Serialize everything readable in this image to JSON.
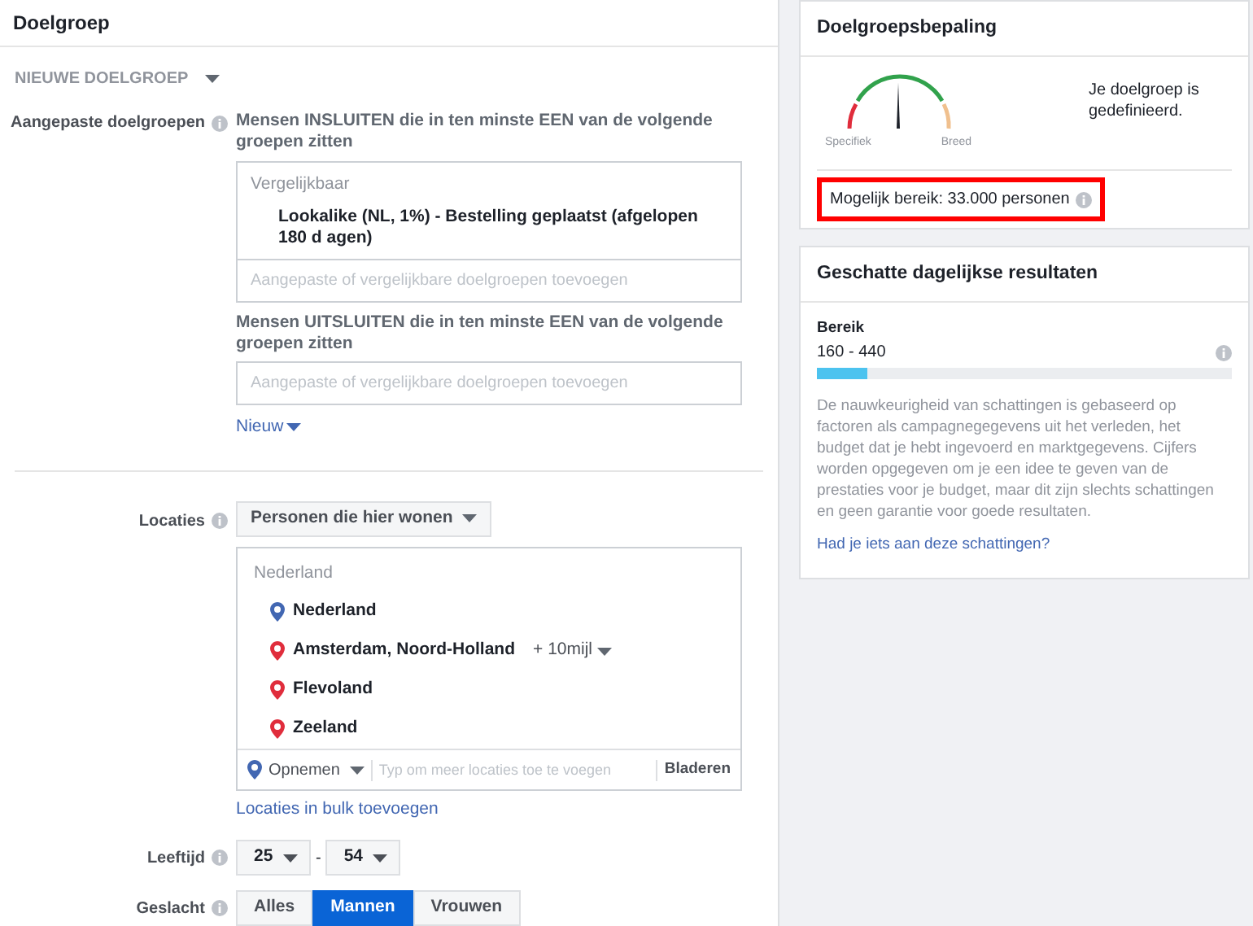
{
  "main": {
    "title": "Doelgroep",
    "audience_menu": "NIEUWE DOELGROEP",
    "custom_audiences": {
      "label": "Aangepaste doelgroepen",
      "include_heading": "Mensen INSLUITEN die in ten minste EEN van de volgende groepen zitten",
      "group_heading": "Vergelijkbaar",
      "items": [
        "Lookalike (NL, 1%) - Bestelling geplaatst (afgelopen 180 d agen)"
      ],
      "include_placeholder": "Aangepaste of vergelijkbare doelgroepen toevoegen",
      "exclude_heading": "Mensen UITSLUITEN die in ten minste EEN van de volgende groepen zitten",
      "exclude_placeholder": "Aangepaste of vergelijkbare doelgroepen toevoegen",
      "new_link": "Nieuw"
    },
    "locations": {
      "label": "Locaties",
      "type_select": "Personen die hier wonen",
      "group_heading": "Nederland",
      "items": [
        {
          "name": "Nederland",
          "kind": "include"
        },
        {
          "name": "Amsterdam, Noord-Holland",
          "kind": "exclude",
          "radius": "+ 10mijl"
        },
        {
          "name": "Flevoland",
          "kind": "exclude"
        },
        {
          "name": "Zeeland",
          "kind": "exclude"
        }
      ],
      "mode_select": "Opnemen",
      "placeholder": "Typ om meer locaties toe te voegen",
      "browse": "Bladeren",
      "bulk_link": "Locaties in bulk toevoegen"
    },
    "age": {
      "label": "Leeftijd",
      "min": "25",
      "separator": "-",
      "max": "54"
    },
    "gender": {
      "label": "Geslacht",
      "options": [
        {
          "label": "Alles",
          "selected": false
        },
        {
          "label": "Mannen",
          "selected": true
        },
        {
          "label": "Vrouwen",
          "selected": false
        }
      ]
    }
  },
  "definition": {
    "title": "Doelgroepsbepaling",
    "gauge_left": "Specifiek",
    "gauge_right": "Breed",
    "status": "Je doelgroep is gedefinieerd.",
    "reach": "Mogelijk bereik: 33.000 personen",
    "highlighted": true
  },
  "estimates": {
    "title": "Geschatte dagelijkse resultaten",
    "metric": "Bereik",
    "range": "160 - 440",
    "level": 0.12,
    "note": "De nauwkeurigheid van schattingen is gebaseerd op factoren als campagnegegevens uit het verleden, het budget dat je hebt ingevoerd en marktgegevens. Cijfers worden opgegeven om je een idee te geven van de prestaties voor je budget, maar dit zijn slechts schattingen en geen garantie voor goede resultaten.",
    "feedback_link": "Had je iets aan deze schattingen?"
  }
}
